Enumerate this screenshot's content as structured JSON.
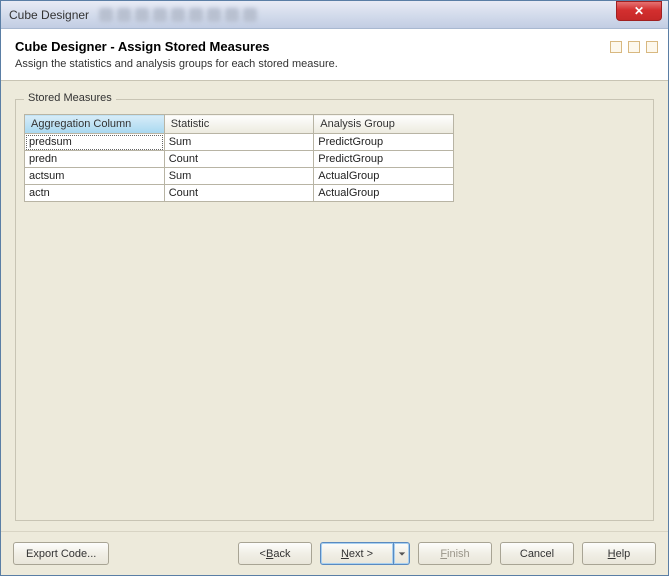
{
  "window": {
    "title": "Cube Designer"
  },
  "header": {
    "title": "Cube Designer - Assign Stored Measures",
    "description": "Assign the statistics and analysis groups for each stored measure."
  },
  "group": {
    "label": "Stored Measures"
  },
  "table": {
    "columns": [
      "Aggregation Column",
      "Statistic",
      "Analysis Group"
    ],
    "rows": [
      {
        "agg": "predsum",
        "stat": "Sum",
        "group": "PredictGroup"
      },
      {
        "agg": "predn",
        "stat": "Count",
        "group": "PredictGroup"
      },
      {
        "agg": "actsum",
        "stat": "Sum",
        "group": "ActualGroup"
      },
      {
        "agg": "actn",
        "stat": "Count",
        "group": "ActualGroup"
      }
    ]
  },
  "buttons": {
    "export": "Export Code...",
    "back_prefix": "< ",
    "back_u": "B",
    "back_suffix": "ack",
    "next_u": "N",
    "next_suffix": "ext >",
    "finish_prefix": "",
    "finish_u": "F",
    "finish_suffix": "inish",
    "cancel": "Cancel",
    "help_u": "H",
    "help_suffix": "elp"
  }
}
